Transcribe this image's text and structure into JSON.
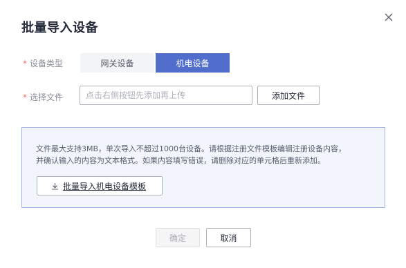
{
  "dialog": {
    "title": "批量导入设备",
    "close_icon": "close-icon"
  },
  "form": {
    "device_type": {
      "label": "设备类型",
      "required_mark": "*",
      "options": [
        {
          "label": "网关设备",
          "selected": false
        },
        {
          "label": "机电设备",
          "selected": true
        }
      ]
    },
    "file": {
      "label": "选择文件",
      "required_mark": "*",
      "value": "",
      "placeholder": "点击右侧按钮先添加再上传",
      "add_button": "添加文件"
    }
  },
  "info": {
    "line1": "文件最大支持3MB，单次导入不超过1000台设备。请根据注册文件模板编辑注册设备内容，",
    "line2": "并确认输入的内容为文本格式。如果内容填写错误，请删除对应的单元格后重新添加。",
    "template_button": "批量导入机电设备模板",
    "template_icon": "download-icon"
  },
  "footer": {
    "ok": "确定",
    "ok_disabled": true,
    "cancel": "取消"
  },
  "colors": {
    "primary": "#526ecc",
    "required": "#f66f6a",
    "info_bg": "#f2f5fc",
    "info_border": "#a2b3ea"
  }
}
